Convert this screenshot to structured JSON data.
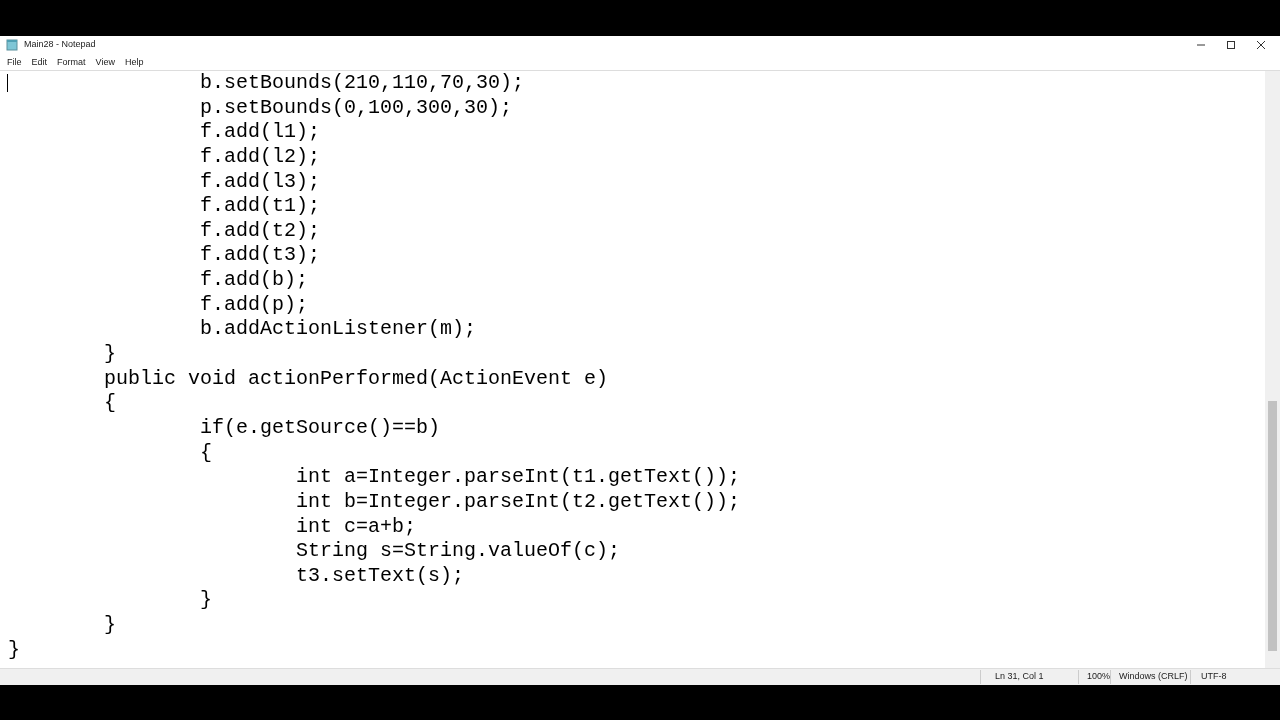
{
  "window": {
    "title": "Main28 - Notepad"
  },
  "menu": [
    "File",
    "Edit",
    "Format",
    "View",
    "Help"
  ],
  "editor": {
    "lines": [
      "\t\tb.setBounds(210,110,70,30);",
      "\t\tp.setBounds(0,100,300,30);",
      "\t\tf.add(l1);",
      "\t\tf.add(l2);",
      "\t\tf.add(l3);",
      "\t\tf.add(t1);",
      "\t\tf.add(t2);",
      "\t\tf.add(t3);",
      "\t\tf.add(b);",
      "\t\tf.add(p);",
      "\t\tb.addActionListener(m);",
      "\t}",
      "\tpublic void actionPerformed(ActionEvent e)",
      "\t{",
      "\t\tif(e.getSource()==b)",
      "\t\t{",
      "\t\t\tint a=Integer.parseInt(t1.getText());",
      "\t\t\tint b=Integer.parseInt(t2.getText());",
      "\t\t\tint c=a+b;",
      "\t\t\tString s=String.valueOf(c);",
      "\t\t\tt3.setText(s);",
      "\t\t}",
      "\t}",
      "}"
    ]
  },
  "status_bar": {
    "position": "Ln 31, Col 1",
    "zoom": "100%",
    "line_endings": "Windows (CRLF)",
    "encoding": "UTF-8"
  }
}
